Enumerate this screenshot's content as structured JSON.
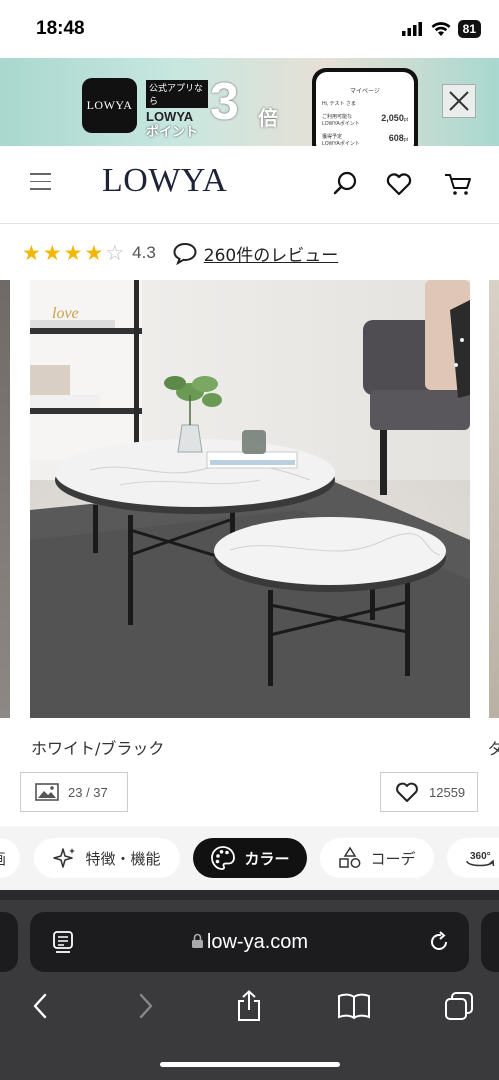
{
  "status_bar": {
    "time": "18:48",
    "battery": "81"
  },
  "banner": {
    "logo": "LOWYA",
    "tag_small": "公式アプリなら",
    "tag_line1": "LOWYA",
    "tag_line2": "ポイント",
    "multiplier": "3",
    "multiplier_suffix": "倍",
    "phone": {
      "title": "マイページ",
      "greeting": "Hi, テスト さま",
      "row1_label": "ご利用可能な LOWYAポイント",
      "row1_value": "2,050",
      "row1_unit": "pt",
      "row2_label": "獲得予定 LOWYAポイント",
      "row2_value": "608",
      "row2_unit": "pt"
    }
  },
  "header": {
    "logo": "LOWYA"
  },
  "rating": {
    "value": "4.3",
    "stars_full": 4,
    "stars_total": 5,
    "review_link": "260件のレビュー"
  },
  "product": {
    "color_label": "ホワイト/ブラック",
    "next_color_peek": "ダ",
    "image_counter": "23 / 37",
    "favorite_count": "12559"
  },
  "tabs": {
    "partial_left": "画",
    "features": "特徴・機能",
    "color": "カラー",
    "coordinate": "コーデ",
    "view360": "360°"
  },
  "browser": {
    "url": "low-ya.com"
  },
  "colors": {
    "accent_star": "#f2b705",
    "banner_mint": "#a9d8cf",
    "logo_navy": "#1d2438"
  }
}
